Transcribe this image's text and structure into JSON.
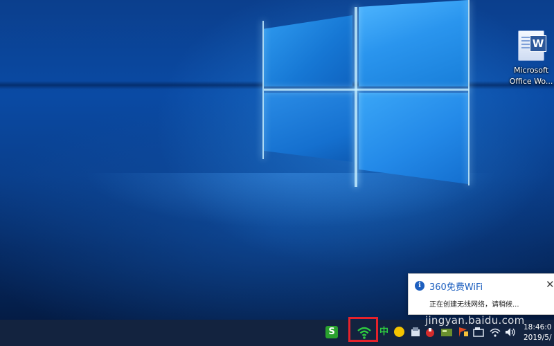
{
  "desktop": {
    "icons": [
      {
        "label": "Microsoft\nOffice Wo...",
        "glyph": "W",
        "icon": "word-document-icon"
      }
    ]
  },
  "notification": {
    "title": "360免费WiFi",
    "message": "正在创建无线网络，请稍候...",
    "close_glyph": "✕",
    "info_glyph": "i"
  },
  "taskbar": {
    "tray": {
      "sogou_label": "S",
      "ime_label": "中",
      "icons": [
        "sogou-input-icon",
        "wifi-360-icon",
        "chinese-ime-icon",
        "yellow-app-icon",
        "tray-app-icon",
        "security-icon",
        "tray-card-icon",
        "flag-icon",
        "folder-icon",
        "network-icon",
        "volume-icon"
      ],
      "highlight_color": "#e5222b"
    },
    "clock": {
      "time": "18:46:0",
      "date": "2019/5/"
    }
  },
  "watermark": "jingyan.baidu.com"
}
